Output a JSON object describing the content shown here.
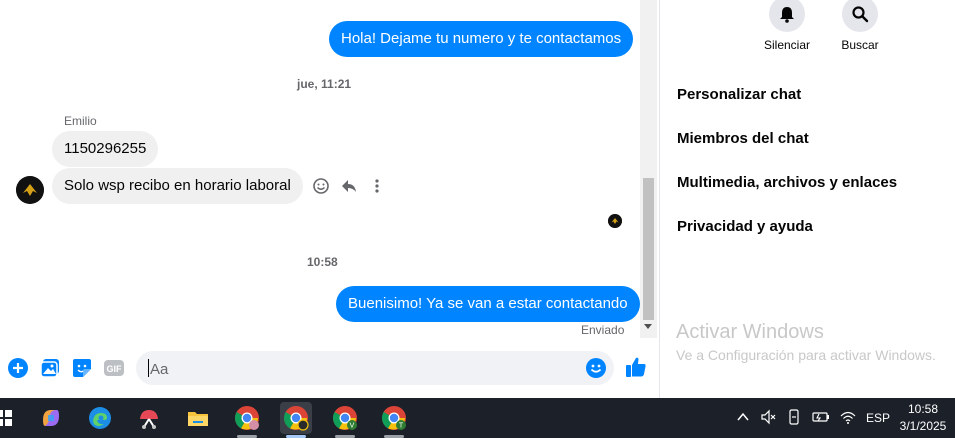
{
  "chat": {
    "top_partial_date": "·",
    "messages": [
      {
        "text": "Hola! Dejame tu numero y te contactamos"
      },
      {
        "time_label": "jue, 11:21"
      },
      {
        "sender": "Emilio"
      },
      {
        "text": "1150296255"
      },
      {
        "text": "Solo wsp recibo en horario laboral"
      },
      {
        "time_label": "10:58"
      },
      {
        "text": "Buenisimo! Ya se van a estar contactando"
      }
    ],
    "status": "Enviado",
    "composer": {
      "placeholder": "Aa",
      "gif_label": "GIF"
    }
  },
  "sidebar": {
    "actions": [
      {
        "label": "Silenciar",
        "icon": "bell-icon"
      },
      {
        "label": "Buscar",
        "icon": "search-icon"
      }
    ],
    "menu": [
      "Personalizar chat",
      "Miembros del chat",
      "Multimedia, archivos y enlaces",
      "Privacidad y ayuda"
    ],
    "watermark": {
      "title": "Activar Windows",
      "subtitle": "Ve a Configuración para activar Windows."
    }
  },
  "taskbar": {
    "language": "ESP",
    "time": "10:58",
    "date": "3/1/2025",
    "chrome_badges": [
      "",
      "",
      "V",
      "T"
    ]
  },
  "colors": {
    "accent": "#0084ff",
    "incoming": "#f0f0f0",
    "taskbar": "#1c2129"
  }
}
